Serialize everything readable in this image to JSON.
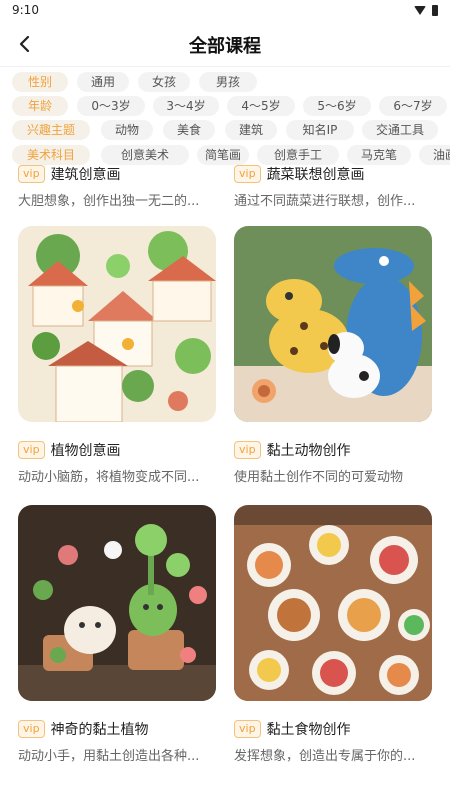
{
  "status": {
    "time": "9:10"
  },
  "header": {
    "title": "全部课程"
  },
  "filters": {
    "gender": {
      "label": "性别",
      "options": [
        "通用",
        "女孩",
        "男孩"
      ]
    },
    "age": {
      "label": "年龄",
      "options": [
        "0～3岁",
        "3～4岁",
        "4～5岁",
        "5～6岁",
        "6～7岁"
      ]
    },
    "interest": {
      "label": "兴趣主题",
      "options": [
        "动物",
        "美食",
        "建筑",
        "知名IP",
        "交通工具"
      ]
    },
    "art": {
      "label": "美术科目",
      "options": [
        "创意美术",
        "简笔画",
        "创意手工",
        "马克笔",
        "油画"
      ]
    }
  },
  "vip_label": "vip",
  "courses": [
    {
      "title": "建筑创意画",
      "desc": "大胆想象，创作出独一无二的..."
    },
    {
      "title": "蔬菜联想创意画",
      "desc": "通过不同蔬菜进行联想，创作..."
    },
    {
      "title": "植物创意画",
      "desc": "动动小脑筋，将植物变成不同..."
    },
    {
      "title": "黏土动物创作",
      "desc": "使用黏土创作不同的可爱动物"
    },
    {
      "title": "神奇的黏土植物",
      "desc": "动动小手，用黏土创造出各种..."
    },
    {
      "title": "黏土食物创作",
      "desc": "发挥想象，创造出专属于你的..."
    }
  ]
}
